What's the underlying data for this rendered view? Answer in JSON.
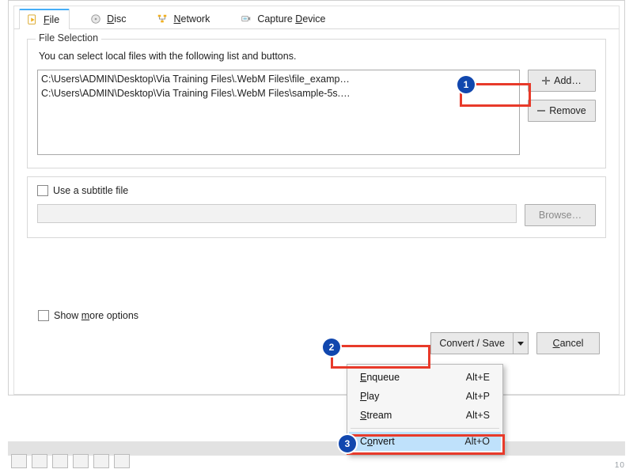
{
  "tabs": {
    "file": "File",
    "disc": "Disc",
    "network": "Network",
    "capture": "Capture Device"
  },
  "fileSelection": {
    "title": "File Selection",
    "subtext": "You can select local files with the following list and buttons.",
    "items": [
      "C:\\Users\\ADMIN\\Desktop\\Via Training Files\\.WebM Files\\file_examp…",
      "C:\\Users\\ADMIN\\Desktop\\Via Training Files\\.WebM Files\\sample-5s.…"
    ],
    "add": "Add…",
    "remove": "Remove"
  },
  "subtitle": {
    "checkbox_label": "Use a subtitle file",
    "browse": "Browse…"
  },
  "options_label": "Show more options",
  "bottom": {
    "convert_save": "Convert / Save",
    "cancel": "Cancel"
  },
  "menu": {
    "enqueue": {
      "label": "Enqueue",
      "shortcut": "Alt+E"
    },
    "play": {
      "label": "Play",
      "shortcut": "Alt+P"
    },
    "stream": {
      "label": "Stream",
      "shortcut": "Alt+S"
    },
    "convert": {
      "label": "Convert",
      "shortcut": "Alt+O"
    }
  },
  "annotations": {
    "b1": "1",
    "b2": "2",
    "b3": "3"
  },
  "page_number": "10"
}
